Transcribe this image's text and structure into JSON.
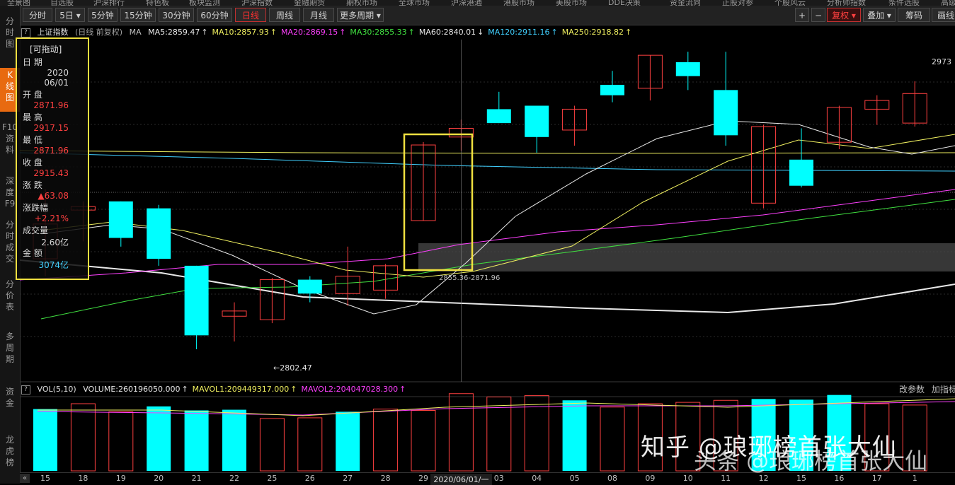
{
  "top_menu": [
    "全景图",
    "自选股",
    "沪深排行",
    "特色板",
    "板块监测",
    "沪深指数",
    "金融期货",
    "期权市场",
    "全球市场",
    "沪深港通",
    "港股市场",
    "美股市场",
    "DDE决策",
    "资金流向",
    "正股对参",
    "个股风云",
    "分析师指数",
    "条件选股",
    "高级选股"
  ],
  "toolbar": {
    "buttons": [
      "分时",
      "5日",
      "5分钟",
      "15分钟",
      "30分钟",
      "60分钟",
      "日线",
      "周线",
      "月线",
      "更多周期"
    ],
    "active": "日线",
    "right": {
      "plus": "+",
      "minus": "−",
      "fuquan": "复权",
      "diejia": "叠加",
      "chouma": "筹码",
      "huaxian": "画线"
    }
  },
  "sidebar": [
    {
      "label": "分\n时\n图",
      "active": false
    },
    {
      "label": "K\n线\n图",
      "active": true
    },
    {
      "label": "F10\n资\n料",
      "active": false
    },
    {
      "label": "深\n度\nF9",
      "active": false
    },
    {
      "label": "分\n时\n成\n交",
      "active": false
    },
    {
      "label": "分\n价\n表",
      "active": false
    },
    {
      "label": "多\n周\n期",
      "active": false
    },
    {
      "label": "资\n金",
      "active": false
    },
    {
      "label": "龙\n虎\n榜",
      "active": false
    }
  ],
  "ma_line": {
    "title": "上证指数",
    "subtitle": "(日线 前复权)",
    "ma_label": "MA",
    "items": [
      {
        "text": "MA5:2859.47",
        "color": "#e8e8e8"
      },
      {
        "text": "MA10:2857.93",
        "color": "#f0f060"
      },
      {
        "text": "MA20:2869.15",
        "color": "#ff40ff"
      },
      {
        "text": "MA30:2855.33",
        "color": "#40e040"
      },
      {
        "text": "MA60:2840.01",
        "color": "#e8e8e8"
      },
      {
        "text": "MA120:2911.16",
        "color": "#40d0ff"
      },
      {
        "text": "MA250:2918.82",
        "color": "#f0f060"
      }
    ]
  },
  "vol_line": {
    "title": "VOL(5,10)",
    "items": [
      {
        "text": "VOLUME:260196050.000",
        "color": "#e8e8e8"
      },
      {
        "text": "MAVOL1:209449317.000",
        "color": "#f0f060"
      },
      {
        "text": "MAVOL2:204047028.300",
        "color": "#ff40ff"
      }
    ],
    "right_links": [
      "改参数",
      "加指标"
    ]
  },
  "info_panel": {
    "title": "[可拖动]",
    "rows": [
      {
        "label": "日  期",
        "value": "2020",
        "color": "#d8d8d8"
      },
      {
        "label": "",
        "value": "06/01",
        "color": "#d8d8d8"
      },
      {
        "label": "开  盘",
        "value": "2871.96",
        "color": "#ff4040"
      },
      {
        "label": "最  高",
        "value": "2917.15",
        "color": "#ff4040"
      },
      {
        "label": "最  低",
        "value": "2871.96",
        "color": "#ff4040"
      },
      {
        "label": "收  盘",
        "value": "2915.43",
        "color": "#ff4040"
      },
      {
        "label": "涨  跌",
        "value": "▲63.08",
        "color": "#ff4040"
      },
      {
        "label": "涨跌幅",
        "value": "+2.21%",
        "color": "#ff4040"
      },
      {
        "label": "成交量",
        "value": "2.60亿",
        "color": "#d8d8d8"
      },
      {
        "label": "金  额",
        "value": "3074亿",
        "color": "#40d0ff"
      }
    ]
  },
  "annotations": {
    "low_marker": "2802.47",
    "cross_label": "2855.36-2871.96",
    "price_right": "2973"
  },
  "dates": [
    "15",
    "18",
    "19",
    "20",
    "21",
    "22",
    "25",
    "26",
    "27",
    "28",
    "29",
    "2020/06/01/一",
    "03",
    "04",
    "05",
    "08",
    "09",
    "10",
    "11",
    "12",
    "15",
    "16",
    "17",
    "1"
  ],
  "candles": [
    {
      "o": 2870,
      "c": 2850,
      "h": 2890,
      "l": 2840,
      "up": true
    },
    {
      "o": 2878,
      "c": 2880,
      "h": 2883,
      "l": 2860,
      "up": true
    },
    {
      "o": 2883,
      "c": 2862,
      "h": 2883,
      "l": 2857,
      "up": false
    },
    {
      "o": 2879,
      "c": 2850,
      "h": 2881,
      "l": 2846,
      "up": false
    },
    {
      "o": 2846,
      "c": 2806,
      "h": 2846,
      "l": 2798,
      "up": false
    },
    {
      "o": 2817,
      "c": 2820,
      "h": 2825,
      "l": 2802.47,
      "up": true
    },
    {
      "o": 2815,
      "c": 2838,
      "h": 2839,
      "l": 2813,
      "up": true
    },
    {
      "o": 2838,
      "c": 2830,
      "h": 2840,
      "l": 2825,
      "up": false
    },
    {
      "o": 2830,
      "c": 2840,
      "h": 2857,
      "l": 2823,
      "up": true
    },
    {
      "o": 2832,
      "c": 2846,
      "h": 2847,
      "l": 2827,
      "up": true
    },
    {
      "o": 2871.96,
      "c": 2915.43,
      "h": 2917.15,
      "l": 2871.96,
      "up": true
    },
    {
      "o": 2920,
      "c": 2925,
      "h": 2930,
      "l": 2912,
      "up": true
    },
    {
      "o": 2928,
      "c": 2936,
      "h": 2946,
      "l": 2928,
      "up": false
    },
    {
      "o": 2920,
      "c": 2938,
      "h": 2938,
      "l": 2911,
      "up": false
    },
    {
      "o": 2924,
      "c": 2936,
      "h": 2938,
      "l": 2915,
      "up": true
    },
    {
      "o": 2944,
      "c": 2950,
      "h": 2958,
      "l": 2940,
      "up": false
    },
    {
      "o": 2948,
      "c": 2967,
      "h": 2967,
      "l": 2941,
      "up": true
    },
    {
      "o": 2955,
      "c": 2963,
      "h": 2969,
      "l": 2947,
      "up": false
    },
    {
      "o": 2921,
      "c": 2947,
      "h": 2969,
      "l": 2915,
      "up": false
    },
    {
      "o": 2882,
      "c": 2926,
      "h": 2927,
      "l": 2879,
      "up": true
    },
    {
      "o": 2892,
      "c": 2907,
      "h": 2925,
      "l": 2891,
      "up": false
    },
    {
      "o": 2917,
      "c": 2937,
      "h": 2938,
      "l": 2913,
      "up": true
    },
    {
      "o": 2936,
      "c": 2941,
      "h": 2944,
      "l": 2927,
      "up": true
    },
    {
      "o": 2928,
      "c": 2945,
      "h": 2952,
      "l": 2926,
      "up": true
    }
  ],
  "volumes": [
    {
      "v": 0.92,
      "up": false
    },
    {
      "v": 1.0,
      "up": true
    },
    {
      "v": 0.88,
      "up": true
    },
    {
      "v": 0.96,
      "up": false
    },
    {
      "v": 0.9,
      "up": false
    },
    {
      "v": 0.91,
      "up": false
    },
    {
      "v": 0.78,
      "up": true
    },
    {
      "v": 0.79,
      "up": true
    },
    {
      "v": 0.88,
      "up": false
    },
    {
      "v": 0.92,
      "up": true
    },
    {
      "v": 0.9,
      "up": true
    },
    {
      "v": 1.15,
      "up": true
    },
    {
      "v": 1.1,
      "up": true
    },
    {
      "v": 1.12,
      "up": true
    },
    {
      "v": 1.05,
      "up": false
    },
    {
      "v": 0.95,
      "up": true
    },
    {
      "v": 1.0,
      "up": true
    },
    {
      "v": 1.02,
      "up": true
    },
    {
      "v": 1.05,
      "up": true
    },
    {
      "v": 1.07,
      "up": false
    },
    {
      "v": 1.06,
      "up": false
    },
    {
      "v": 1.13,
      "up": false
    },
    {
      "v": 1.0,
      "up": true
    },
    {
      "v": 0.98,
      "up": true
    }
  ],
  "watermark": "知乎 @琅琊榜首张大仙",
  "watermark2": "头条 @琅琊榜首张大仙",
  "colors": {
    "up": "#ff4040",
    "down": "#00ffff",
    "accent": "#f0e040"
  }
}
